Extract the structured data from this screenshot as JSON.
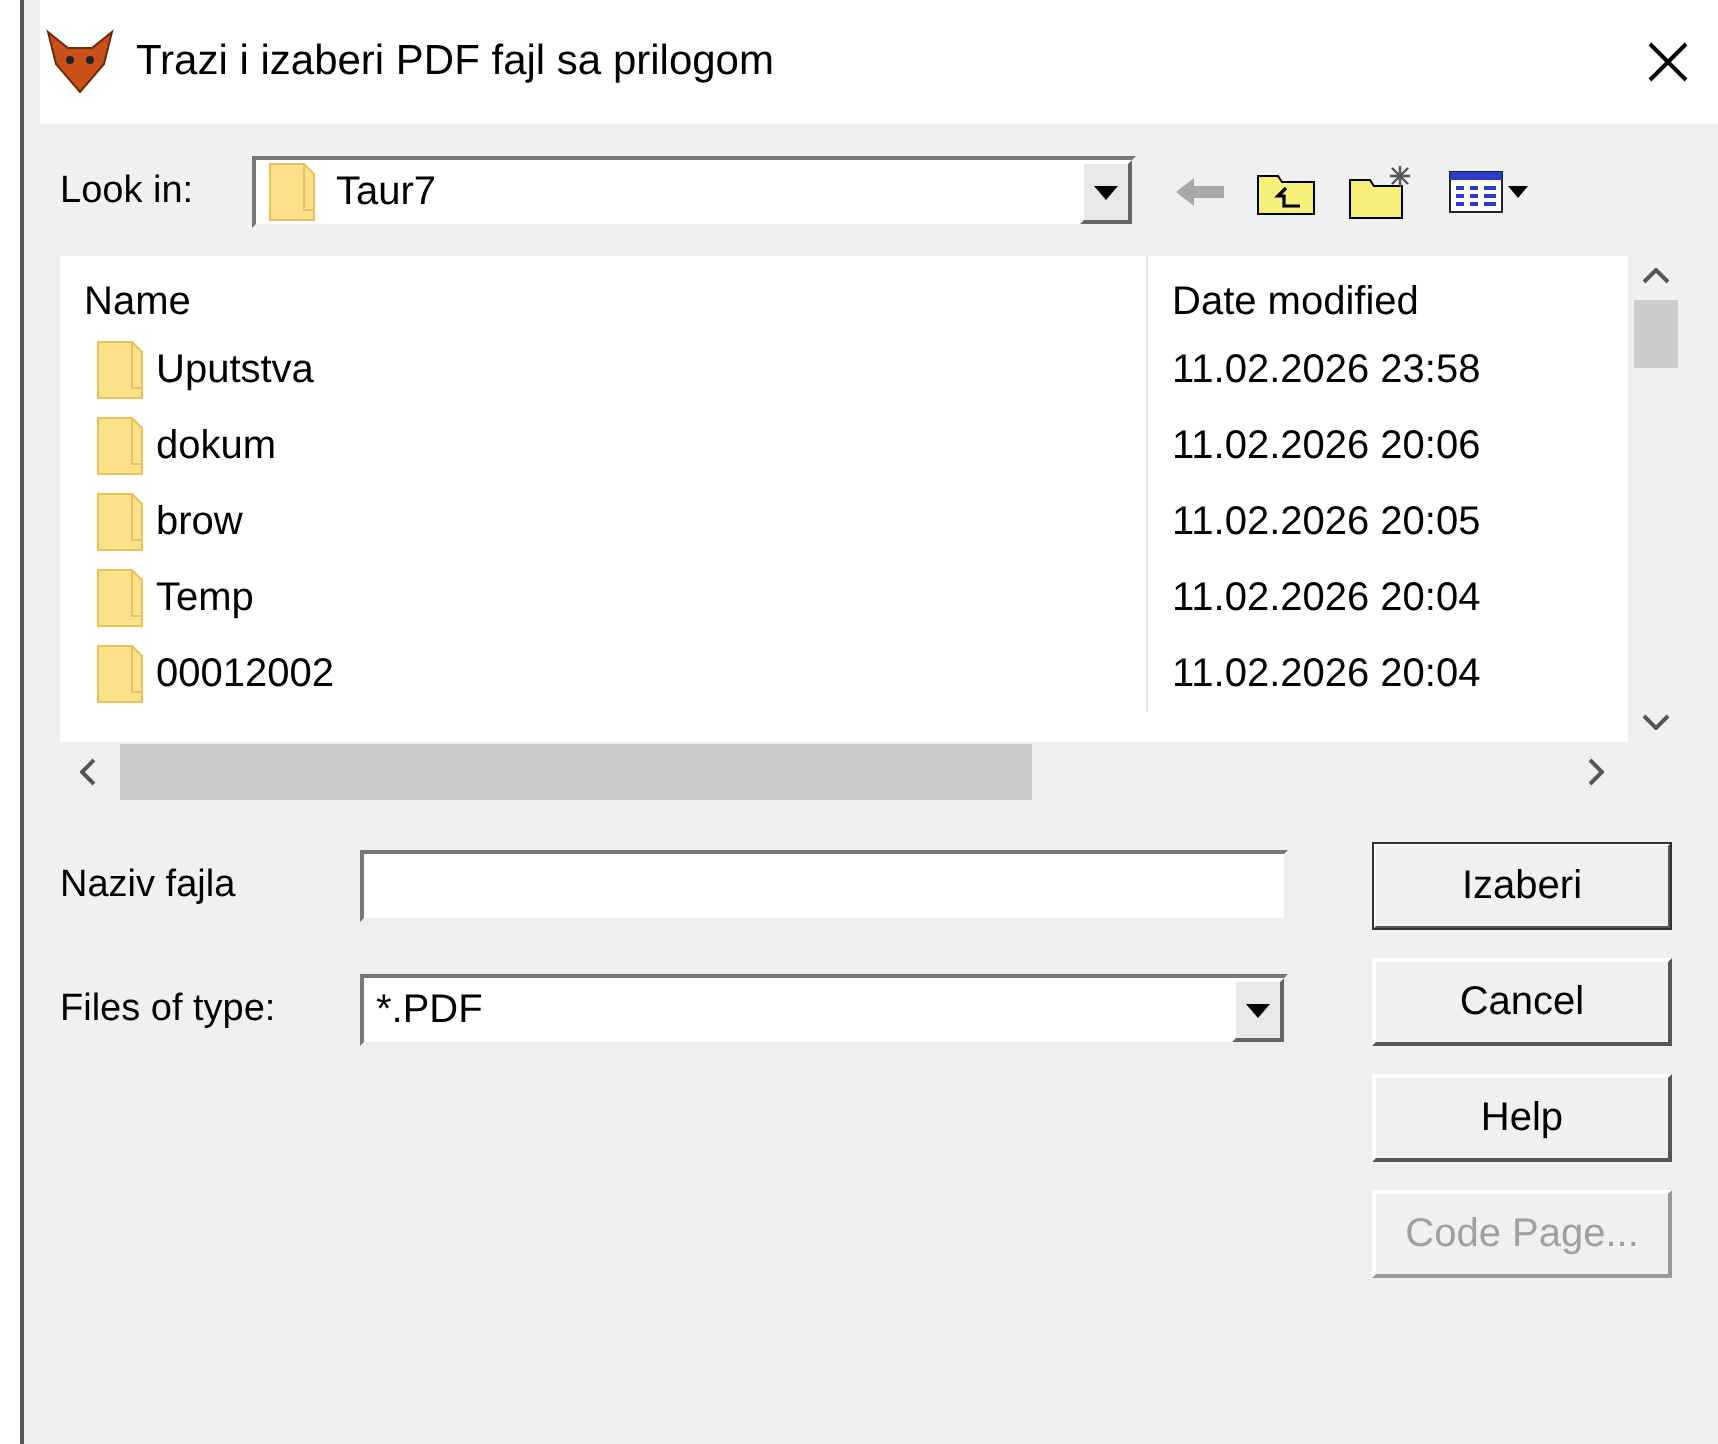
{
  "window": {
    "title": "Trazi i izaberi PDF fajl sa prilogom"
  },
  "look_in": {
    "label": "Look in:",
    "value": "Taur7"
  },
  "file_list": {
    "columns": [
      "Name",
      "Date modified"
    ],
    "rows": [
      {
        "name": "Uputstva",
        "date": "11.02.2026 23:58"
      },
      {
        "name": "dokum",
        "date": "11.02.2026 20:06"
      },
      {
        "name": "brow",
        "date": "11.02.2026 20:05"
      },
      {
        "name": "Temp",
        "date": "11.02.2026 20:04"
      },
      {
        "name": "00012002",
        "date": "11.02.2026 20:04"
      }
    ]
  },
  "file_name": {
    "label": "Naziv fajla"
  },
  "file_type": {
    "label": "Files of type:",
    "value": "*.PDF"
  },
  "buttons": [
    {
      "label": "Izaberi",
      "disabled": false,
      "default": true
    },
    {
      "label": "Cancel",
      "disabled": false,
      "default": false
    },
    {
      "label": "Help",
      "disabled": false,
      "default": false
    },
    {
      "label": "Code Page...",
      "disabled": true,
      "default": false
    }
  ]
}
